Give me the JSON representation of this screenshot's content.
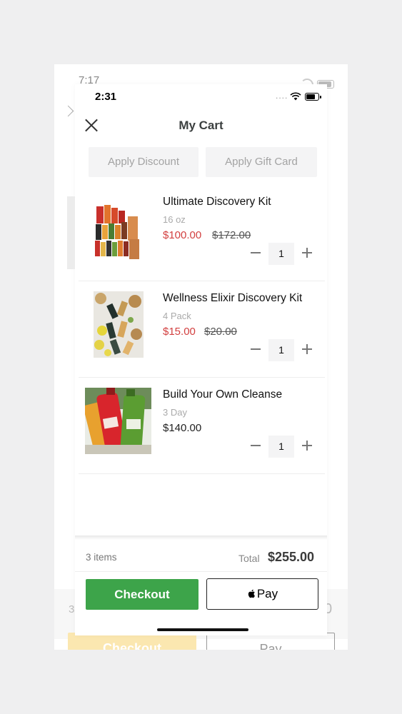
{
  "background_screen": {
    "time": "7:17",
    "item_count_partial": "3",
    "total_partial": "0",
    "checkout_label": "Checkout",
    "pay_label": "Pay"
  },
  "status_bar": {
    "time": "2:31",
    "signal_dots": "....",
    "icons": [
      "wifi-icon",
      "battery-icon"
    ]
  },
  "header": {
    "title": "My Cart",
    "close_icon": "close-icon"
  },
  "actions": {
    "apply_discount": "Apply Discount",
    "apply_gift_card": "Apply Gift Card"
  },
  "items": [
    {
      "name": "Ultimate Discovery Kit",
      "variant": "16 oz",
      "price": "$100.00",
      "original_price": "$172.00",
      "quantity": "1"
    },
    {
      "name": "Wellness Elixir Discovery Kit",
      "variant": "4 Pack",
      "price": "$15.00",
      "original_price": "$20.00",
      "quantity": "1"
    },
    {
      "name": "Build Your Own Cleanse",
      "variant": "3 Day",
      "price": "$140.00",
      "original_price": "",
      "quantity": "1"
    }
  ],
  "summary": {
    "item_count": "3 items",
    "total_label": "Total",
    "total_value": "$255.00"
  },
  "buttons": {
    "checkout": "Checkout",
    "apple_pay": "Pay"
  },
  "colors": {
    "sale_price": "#d23f3f",
    "checkout_green": "#3da44a",
    "pill_bg": "#f4f4f5"
  }
}
